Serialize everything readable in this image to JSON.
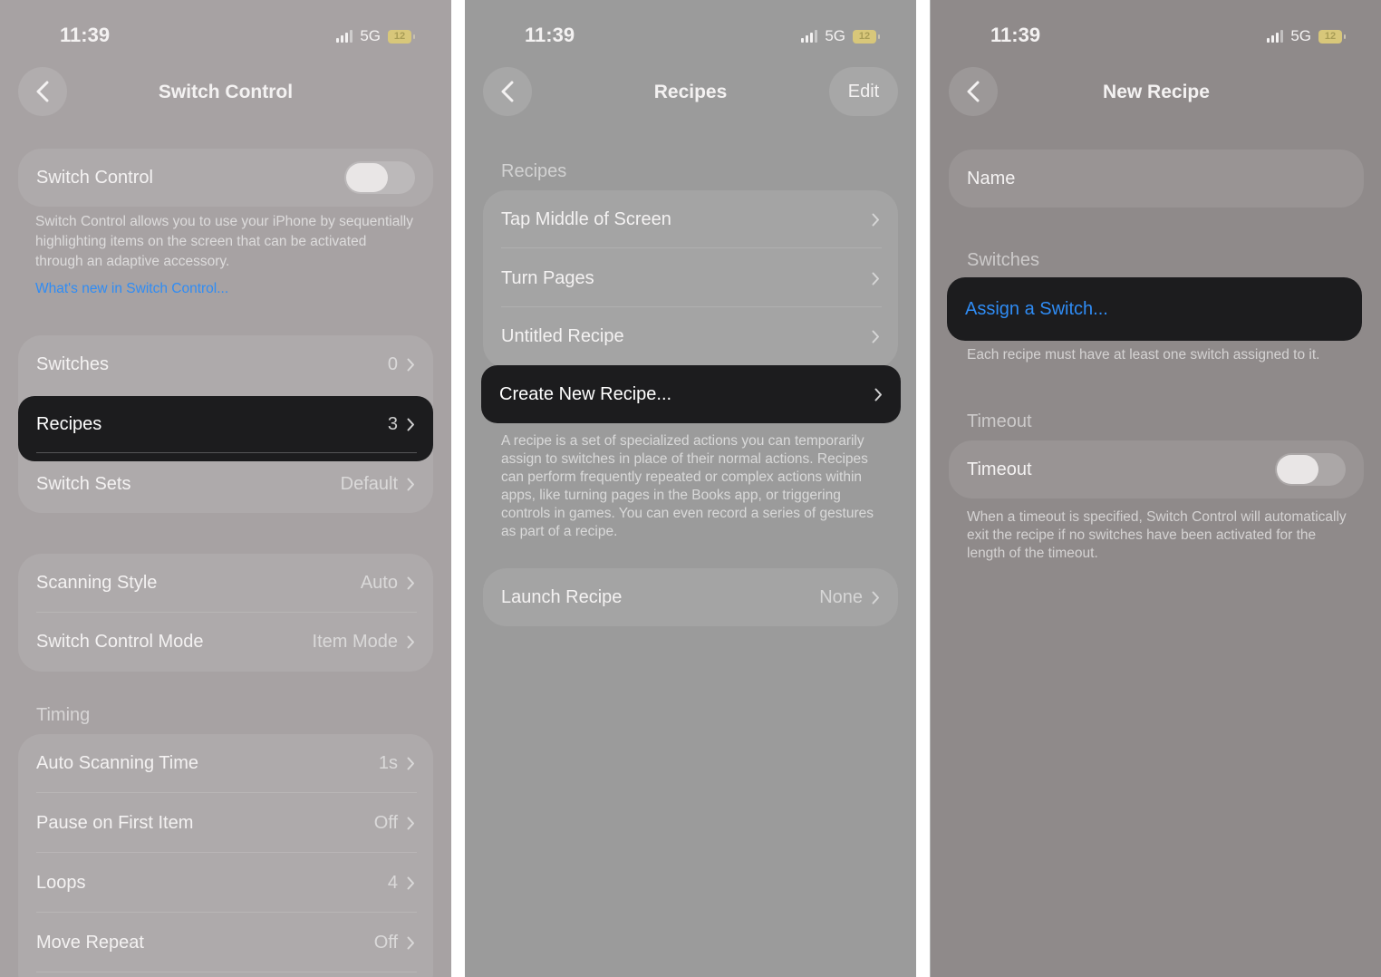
{
  "screen1": {
    "time": "11:39",
    "network": "5G",
    "battery": "12",
    "title": "Switch Control",
    "toggle_label": "Switch Control",
    "description": "Switch Control allows you to use your iPhone by sequentially highlighting items on the screen that can be activated through an adaptive accessory.",
    "link": "What's new in Switch Control...",
    "group1": [
      {
        "label": "Switches",
        "value": "0"
      },
      {
        "label": "Recipes",
        "value": "3"
      },
      {
        "label": "Switch Sets",
        "value": "Default"
      }
    ],
    "group2": [
      {
        "label": "Scanning Style",
        "value": "Auto"
      },
      {
        "label": "Switch Control Mode",
        "value": "Item Mode"
      }
    ],
    "timing_header": "Timing",
    "timing": [
      {
        "label": "Auto Scanning Time",
        "value": "1s"
      },
      {
        "label": "Pause on First Item",
        "value": "Off"
      },
      {
        "label": "Loops",
        "value": "4"
      },
      {
        "label": "Move Repeat",
        "value": "Off"
      }
    ]
  },
  "screen2": {
    "time": "11:39",
    "network": "5G",
    "battery": "12",
    "title": "Recipes",
    "edit": "Edit",
    "section": "Recipes",
    "recipes": [
      {
        "label": "Tap Middle of Screen"
      },
      {
        "label": "Turn Pages"
      },
      {
        "label": "Untitled Recipe"
      },
      {
        "label": "Create New Recipe..."
      }
    ],
    "description": "A recipe is a set of specialized actions you can temporarily assign to switches in place of their normal actions. Recipes can perform frequently repeated or complex actions within apps, like turning pages in the Books app, or triggering controls in games. You can even record a series of gestures as part of a recipe.",
    "launch": {
      "label": "Launch Recipe",
      "value": "None"
    }
  },
  "screen3": {
    "time": "11:39",
    "network": "5G",
    "battery": "12",
    "title": "New Recipe",
    "name_placeholder": "Name",
    "switches_header": "Switches",
    "assign": "Assign a Switch...",
    "assign_note": "Each recipe must have at least one switch assigned to it.",
    "timeout_header": "Timeout",
    "timeout_label": "Timeout",
    "timeout_note": "When a timeout is specified, Switch Control will automatically exit the recipe if no switches have been activated for the length of the timeout."
  },
  "colors": {
    "link": "#2f8cf5",
    "highlight": "#1c1c1e"
  }
}
